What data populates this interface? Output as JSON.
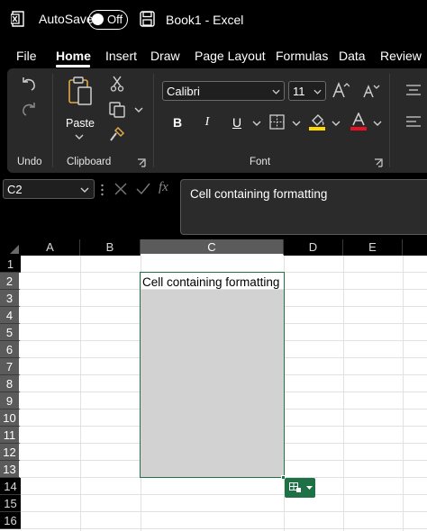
{
  "titlebar": {
    "autosave_label": "AutoSave",
    "autosave_state": "Off",
    "doc_title": "Book1  -  Excel"
  },
  "tabs": [
    "File",
    "Home",
    "Insert",
    "Draw",
    "Page Layout",
    "Formulas",
    "Data",
    "Review"
  ],
  "active_tab": "Home",
  "ribbon": {
    "groups": {
      "undo": "Undo",
      "clipboard": "Clipboard",
      "font": "Font"
    },
    "paste_label": "Paste",
    "font_name": "Calibri",
    "font_size": "11",
    "format_buttons": [
      "B",
      "I",
      "U"
    ],
    "highlight_color": "#ffd800",
    "font_color": "#e81123"
  },
  "formula_bar": {
    "name_box": "C2",
    "fx_label": "fx",
    "formula": "Cell containing formatting"
  },
  "sheet": {
    "columns": [
      "A",
      "B",
      "C",
      "D",
      "E"
    ],
    "selected_column": "C",
    "rows": [
      "1",
      "2",
      "3",
      "4",
      "5",
      "6",
      "7",
      "8",
      "9",
      "10",
      "11",
      "12",
      "13",
      "14",
      "15",
      "16"
    ],
    "selected_rows": [
      "2",
      "3",
      "4",
      "5",
      "6",
      "7",
      "8",
      "9",
      "10",
      "11",
      "12",
      "13"
    ],
    "active_cell_text": "Cell containing formatting",
    "selection_color": "#217346"
  }
}
